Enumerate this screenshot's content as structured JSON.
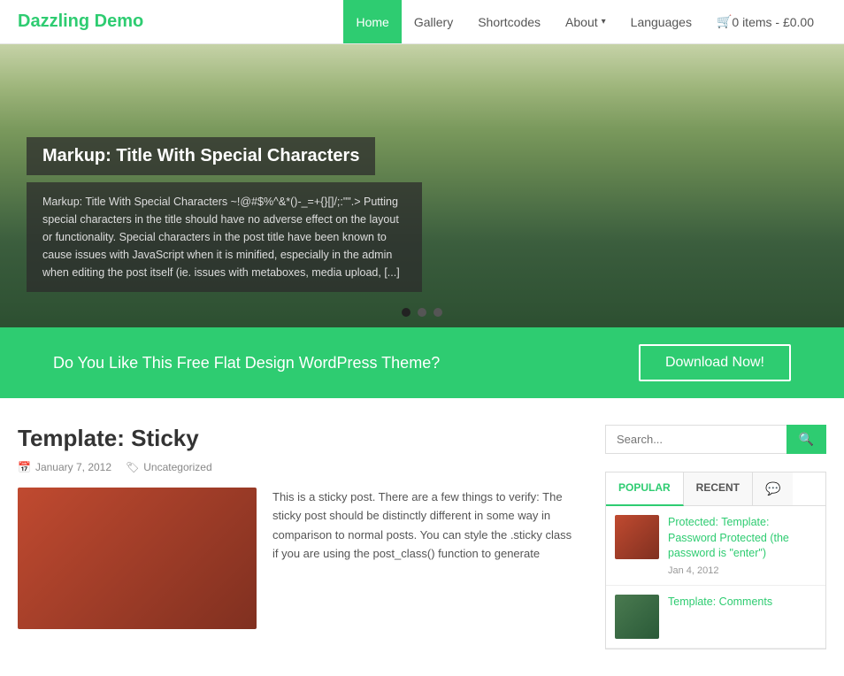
{
  "brand": {
    "name": "Dazzling Demo"
  },
  "nav": {
    "items": [
      {
        "label": "Home",
        "active": true
      },
      {
        "label": "Gallery",
        "active": false
      },
      {
        "label": "Shortcodes",
        "active": false
      },
      {
        "label": "About",
        "active": false,
        "has_caret": true
      },
      {
        "label": "Languages",
        "active": false
      }
    ],
    "cart_label": "0 items - £0.00"
  },
  "hero": {
    "title": "Markup: Title With Special Characters",
    "excerpt": "Markup: Title With Special Characters ~!@#$%^&*()-_=+{}[]/;:\"\".> Putting special characters in the title should have no adverse effect on the layout or functionality. Special characters in the post title have been known to cause issues with JavaScript when it is minified, especially in the admin when editing the post itself (ie. issues with metaboxes, media upload, [...]",
    "dots": [
      {
        "active": true
      },
      {
        "active": false
      },
      {
        "active": false
      }
    ]
  },
  "cta": {
    "text": "Do You Like This Free Flat Design WordPress Theme?",
    "button_label": "Download Now!"
  },
  "post": {
    "title": "Template: Sticky",
    "date": "January 7, 2012",
    "category": "Uncategorized",
    "excerpt": "This is a sticky post. There are a few things to verify: The sticky post should be distinctly different in some way in comparison to normal posts. You can style the .sticky class if you are using the post_class() function to generate"
  },
  "sidebar": {
    "search_placeholder": "Search...",
    "search_button_label": "Search",
    "tabs": [
      {
        "label": "POPULAR",
        "active": true
      },
      {
        "label": "RECENT",
        "active": false
      }
    ],
    "tab_items": [
      {
        "title": "Protected: Template: Password Protected (the password is \"enter\")",
        "date": "Jan 4, 2012",
        "thumb_class": "thumb1"
      },
      {
        "title": "Template: Comments",
        "date": "",
        "thumb_class": "thumb2"
      }
    ]
  },
  "colors": {
    "brand_green": "#2ecc71"
  }
}
